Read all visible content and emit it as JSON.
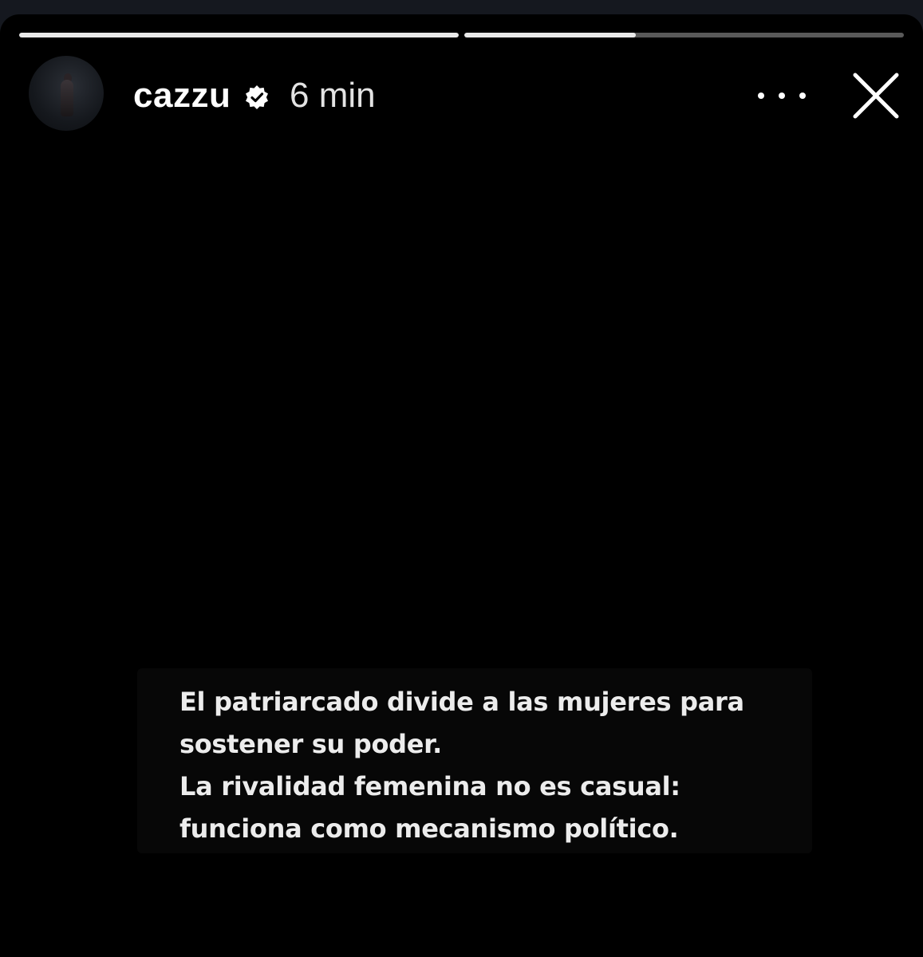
{
  "story": {
    "progress": [
      1.0,
      0.39
    ],
    "username": "cazzu",
    "verified_icon": "verified-badge-icon",
    "time": "6 min",
    "more_icon": "more-options-icon",
    "close_icon": "close-icon",
    "caption_lines": [
      "El patriarcado divide a las mujeres para",
      "sostener su poder.",
      "La rivalidad femenina no es casual:",
      "funciona como mecanismo político."
    ],
    "colors": {
      "background": "#000000",
      "text": "#ececec",
      "progress_fill": "#e9e9e9"
    }
  }
}
